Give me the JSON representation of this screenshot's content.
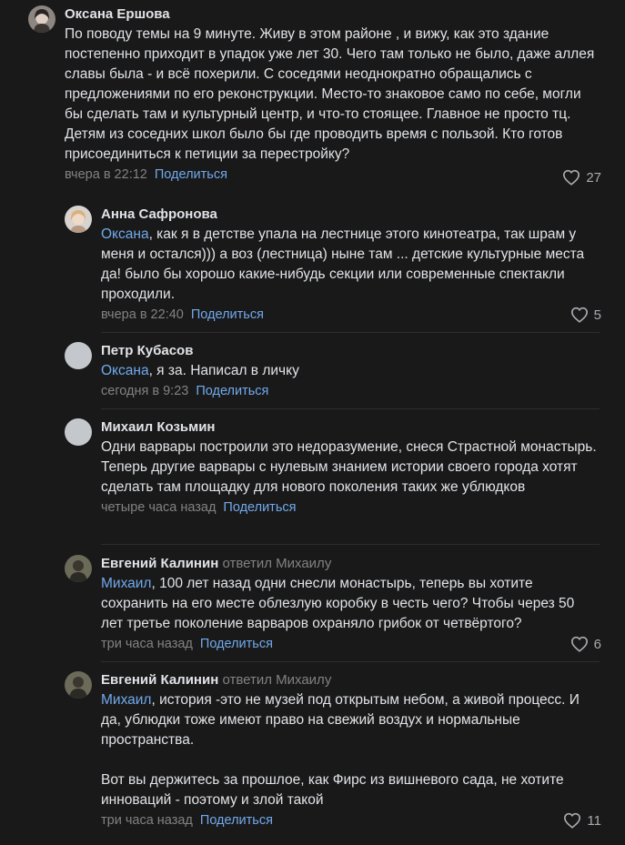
{
  "comments": [
    {
      "author": "Оксана Ершова",
      "replied": "",
      "mention": "",
      "text": "По поводу темы на 9 минуте. Живу в этом районе , и вижу, как это здание постепенно приходит в упадок уже лет 30. Чего там только не было, даже аллея славы была - и всё похерили. С соседями неоднократно обращались с предложениями по его реконструкции. Место-то знаковое само по себе, могли бы сделать там и культурный центр, и что-то стоящее. Главное не просто тц. Детям из соседних школ было бы где проводить время с пользой. Кто готов присоединиться к петиции за перестройку?",
      "time": "вчера в 22:12",
      "share": "Поделиться",
      "likes": "27"
    },
    {
      "author": "Анна Сафронова",
      "replied": "",
      "mention": "Оксана",
      "text": ", как я в детстве упала на лестнице этого кинотеатра, так шрам у меня и остался))) а воз (лестница) ныне там ... детские культурные места да! было бы хорошо какие-нибудь секции или современные спектакли проходили.",
      "time": "вчера в 22:40",
      "share": "Поделиться",
      "likes": "5"
    },
    {
      "author": "Петр Кубасов",
      "replied": "",
      "mention": "Оксана",
      "text": ", я за. Написал в личку",
      "time": "сегодня в 9:23",
      "share": "Поделиться",
      "likes": ""
    },
    {
      "author": "Михаил Козьмин",
      "replied": "",
      "mention": "",
      "text": "Одни варвары построили это недоразумение, снеся Страстной монастырь. Теперь другие варвары с нулевым знанием истории своего города хотят сделать там площадку для нового поколения таких же ублюдков",
      "time": "четыре часа назад",
      "share": "Поделиться",
      "likes": ""
    },
    {
      "author": "Евгений Калинин",
      "replied": "ответил Михаилу",
      "mention": "Михаил",
      "text": ", 100 лет назад одни снесли монастырь, теперь вы хотите сохранить на его месте облезлую коробку в честь чего? Чтобы через 50 лет третье поколение варваров охраняло грибок от четвёртого?",
      "time": "три часа назад",
      "share": "Поделиться",
      "likes": "6"
    },
    {
      "author": "Евгений Калинин",
      "replied": "ответил Михаилу",
      "mention": "Михаил",
      "text": ", история -это не музей под открытым небом, а живой процесс. И да, ублюдки тоже имеют право на свежий воздух и нормальные пространства.\n\nВот вы держитесь за прошлое, как Фирс из вишневого сада, не хотите инноваций - поэтому и злой такой",
      "time": "три часа назад",
      "share": "Поделиться",
      "likes": "11"
    }
  ]
}
